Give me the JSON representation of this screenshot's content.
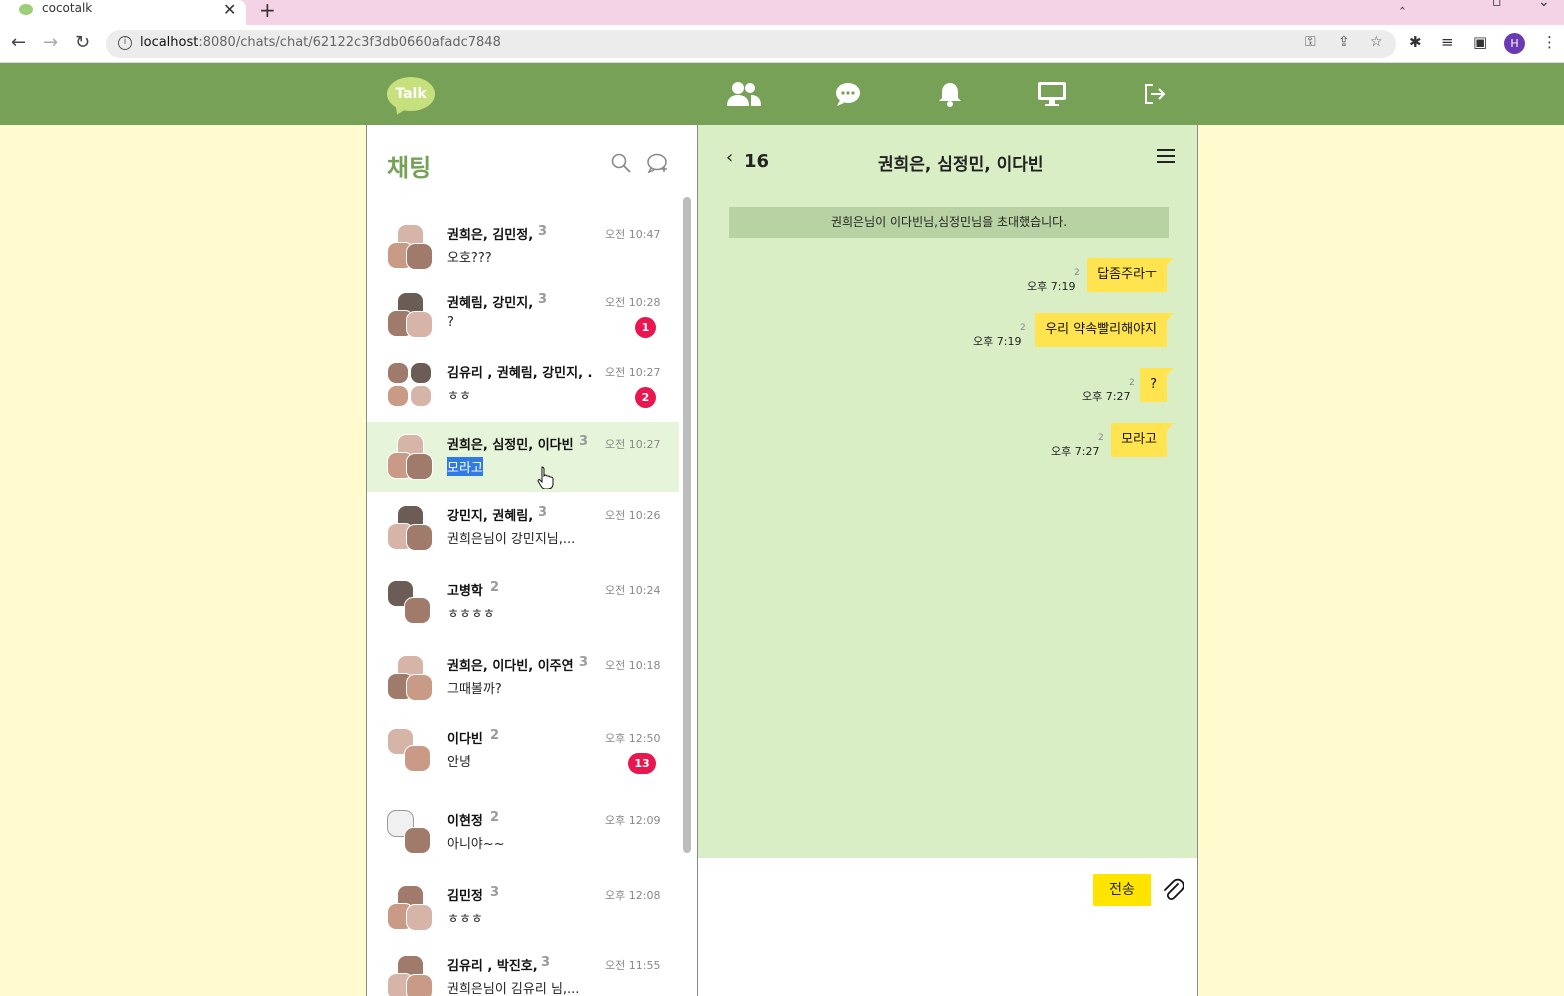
{
  "browser": {
    "tab_title": "cocotalk",
    "url_host": "localhost",
    "url_rest": ":8080/chats/chat/62122c3f3db0660afadc7848",
    "profile_initial": "H"
  },
  "header": {
    "logo_text": "Talk",
    "accent": "#76a157"
  },
  "chat_list": {
    "title": "채팅",
    "items": [
      {
        "name": "권희은, 김민정,",
        "count": "3",
        "time": "오전 10:47",
        "message": "오호???",
        "badge": ""
      },
      {
        "name": "권혜림, 강민지,",
        "count": "3",
        "time": "오전 10:28",
        "message": "?",
        "badge": "1"
      },
      {
        "name": "김유리 , 권혜림, 강민지, ...",
        "count": "",
        "time": "오전 10:27",
        "message": "ㅎㅎ",
        "badge": "2"
      },
      {
        "name": "권희은, 심정민, 이다빈",
        "count": "3",
        "time": "오전 10:27",
        "message": "모라고",
        "badge": ""
      },
      {
        "name": "강민지, 권혜림,",
        "count": "3",
        "time": "오전 10:26",
        "message": "권희은님이 강민지님,...",
        "badge": ""
      },
      {
        "name": "고병학",
        "count": "2",
        "time": "오전 10:24",
        "message": "ㅎㅎㅎㅎ",
        "badge": ""
      },
      {
        "name": "권희은, 이다빈, 이주연",
        "count": "3",
        "time": "오전 10:18",
        "message": "그때볼까?",
        "badge": ""
      },
      {
        "name": "이다빈",
        "count": "2",
        "time": "오후 12:50",
        "message": "안녕",
        "badge": "13"
      },
      {
        "name": "이현정",
        "count": "2",
        "time": "오후 12:09",
        "message": "아니야~~",
        "badge": ""
      },
      {
        "name": "김민정",
        "count": "3",
        "time": "오후 12:08",
        "message": "ㅎㅎㅎ",
        "badge": ""
      },
      {
        "name": "김유리 , 박진호,",
        "count": "3",
        "time": "오전 11:55",
        "message": "권희은님이 김유리 님,...",
        "badge": ""
      }
    ]
  },
  "room": {
    "member_count": "16",
    "title": "권희은, 심정민, 이다빈",
    "system_notice": "권희은님이 이다빈님,심정민님을 초대했습니다.",
    "messages": [
      {
        "text": "답좀주라ㅜ",
        "time": "오후 7:19",
        "unread": "2"
      },
      {
        "text": "우리 약속빨리해야지",
        "time": "오후 7:19",
        "unread": "2"
      },
      {
        "text": "?",
        "time": "오후 7:27",
        "unread": "2"
      },
      {
        "text": "모라고",
        "time": "오후 7:27",
        "unread": "2"
      }
    ],
    "send_label": "전송"
  }
}
